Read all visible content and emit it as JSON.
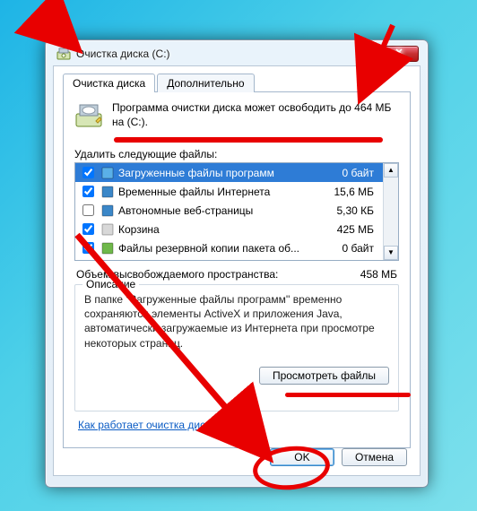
{
  "window": {
    "title": "Очистка диска  (C:)",
    "close_glyph": "✕"
  },
  "tabs": {
    "cleanup": "Очистка диска",
    "more": "Дополнительно"
  },
  "summary": {
    "line1": "Программа очистки диска может освободить до 464 МБ",
    "line2": "на  (C:)."
  },
  "delete_label": "Удалить следующие файлы:",
  "files": [
    {
      "checked": true,
      "name": "Загруженные файлы программ",
      "size": "0 байт",
      "selected": true
    },
    {
      "checked": true,
      "name": "Временные файлы Интернета",
      "size": "15,6 МБ"
    },
    {
      "checked": false,
      "name": "Автономные веб-страницы",
      "size": "5,30 КБ"
    },
    {
      "checked": true,
      "name": "Корзина",
      "size": "425 МБ"
    },
    {
      "checked": true,
      "name": "Файлы резервной копии пакета об...",
      "size": "0 байт"
    }
  ],
  "total": {
    "label": "Объем высвобождаемого пространства:",
    "value": "458 МБ"
  },
  "description": {
    "title": "Описание",
    "text": "В папке ''Загруженные файлы программ'' временно сохраняются элементы ActiveX и приложения Java, автоматически загружаемые из Интернета при просмотре некоторых страниц."
  },
  "buttons": {
    "view_files": "Просмотреть файлы",
    "ok": "OK",
    "cancel": "Отмена"
  },
  "link": "Как работает очистка диска?",
  "scroll": {
    "up": "▲",
    "down": "▼"
  }
}
